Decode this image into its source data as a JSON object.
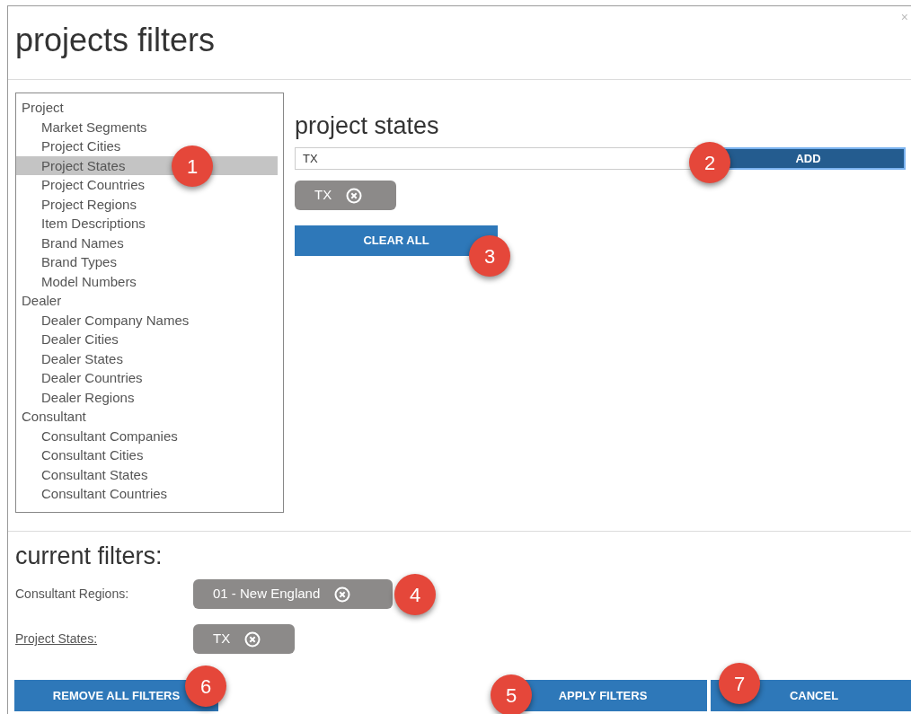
{
  "dialog": {
    "title": "projects filters",
    "close": "×"
  },
  "tree": [
    {
      "label": "Project",
      "selected": false,
      "children": [
        {
          "label": "Market Segments",
          "selected": false
        },
        {
          "label": "Project Cities",
          "selected": false
        },
        {
          "label": "Project States",
          "selected": true
        },
        {
          "label": "Project Countries",
          "selected": false
        },
        {
          "label": "Project Regions",
          "selected": false
        },
        {
          "label": "Item Descriptions",
          "selected": false
        },
        {
          "label": "Brand Names",
          "selected": false
        },
        {
          "label": "Brand Types",
          "selected": false
        },
        {
          "label": "Model Numbers",
          "selected": false
        }
      ]
    },
    {
      "label": "Dealer",
      "selected": false,
      "children": [
        {
          "label": "Dealer Company Names",
          "selected": false
        },
        {
          "label": "Dealer Cities",
          "selected": false
        },
        {
          "label": "Dealer States",
          "selected": false
        },
        {
          "label": "Dealer Countries",
          "selected": false
        },
        {
          "label": "Dealer Regions",
          "selected": false
        }
      ]
    },
    {
      "label": "Consultant",
      "selected": false,
      "children": [
        {
          "label": "Consultant Companies",
          "selected": false
        },
        {
          "label": "Consultant Cities",
          "selected": false
        },
        {
          "label": "Consultant States",
          "selected": false
        },
        {
          "label": "Consultant Countries",
          "selected": false
        }
      ]
    }
  ],
  "editor": {
    "heading": "project states",
    "input_value": "TX",
    "add_button": "ADD",
    "chips": [
      "TX"
    ],
    "clear_button": "CLEAR ALL"
  },
  "current_filters": {
    "heading": "current filters:",
    "rows": [
      {
        "label": "Consultant Regions:",
        "underlined": false,
        "chips": [
          "01 - New England"
        ]
      },
      {
        "label": "Project States:",
        "underlined": true,
        "chips": [
          "TX"
        ]
      }
    ]
  },
  "buttons": {
    "remove_all": "REMOVE ALL FILTERS",
    "apply": "APPLY FILTERS",
    "cancel": "CANCEL"
  },
  "markers": [
    "1",
    "2",
    "3",
    "4",
    "5",
    "6",
    "7"
  ]
}
